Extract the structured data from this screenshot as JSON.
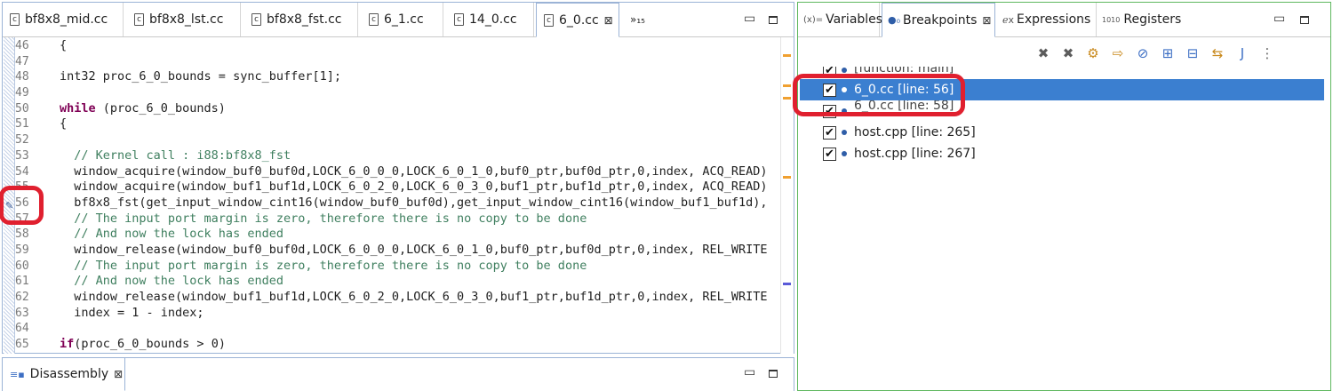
{
  "editor": {
    "tabs": [
      {
        "label": "bf8x8_mid.cc"
      },
      {
        "label": "bf8x8_lst.cc"
      },
      {
        "label": "bf8x8_fst.cc"
      },
      {
        "label": "6_1.cc"
      },
      {
        "label": "14_0.cc"
      },
      {
        "label": "6_0.cc",
        "active": true
      }
    ],
    "overflow_label": "»₁₅",
    "lines": [
      {
        "n": "46",
        "text": "{"
      },
      {
        "n": "47",
        "text": ""
      },
      {
        "n": "48",
        "text": "int32 proc_6_0_bounds = sync_buffer[1];"
      },
      {
        "n": "49",
        "text": ""
      },
      {
        "n": "50",
        "kw": "while",
        "text": " (proc_6_0_bounds)"
      },
      {
        "n": "51",
        "text": "{"
      },
      {
        "n": "52",
        "text": ""
      },
      {
        "n": "53",
        "comment": "  // Kernel call : i88:bf8x8_fst"
      },
      {
        "n": "54",
        "text": "  window_acquire(window_buf0_buf0d,LOCK_6_0_0_0,LOCK_6_0_1_0,buf0_ptr,buf0d_ptr,0,index, ACQ_READ)"
      },
      {
        "n": "55",
        "text": "  window_acquire(window_buf1_buf1d,LOCK_6_0_2_0,LOCK_6_0_3_0,buf1_ptr,buf1d_ptr,0,index, ACQ_READ)"
      },
      {
        "n": "56",
        "text": "  bf8x8_fst(get_input_window_cint16(window_buf0_buf0d),get_input_window_cint16(window_buf1_buf1d),"
      },
      {
        "n": "57",
        "comment": "  // The input port margin is zero, therefore there is no copy to be done"
      },
      {
        "n": "58",
        "comment": "  // And now the lock has ended"
      },
      {
        "n": "59",
        "text": "  window_release(window_buf0_buf0d,LOCK_6_0_0_0,LOCK_6_0_1_0,buf0_ptr,buf0d_ptr,0,index, REL_WRITE"
      },
      {
        "n": "60",
        "comment": "  // The input port margin is zero, therefore there is no copy to be done"
      },
      {
        "n": "61",
        "comment": "  // And now the lock has ended"
      },
      {
        "n": "62",
        "text": "  window_release(window_buf1_buf1d,LOCK_6_0_2_0,LOCK_6_0_3_0,buf1_ptr,buf1d_ptr,0,index, REL_WRITE"
      },
      {
        "n": "63",
        "text": "  index = 1 - index;"
      },
      {
        "n": "64",
        "text": ""
      },
      {
        "n": "65",
        "kw": "if",
        "text": "(proc_6_0_bounds > 0)"
      }
    ]
  },
  "disassembly": {
    "tab_label": "Disassembly"
  },
  "debug": {
    "tabs": [
      {
        "icon": "(x)=",
        "label": "Variables"
      },
      {
        "icon": "●₀",
        "label": "Breakpoints",
        "active": true
      },
      {
        "icon": "ℯx",
        "label": "Expressions"
      },
      {
        "icon": "1010",
        "label": "Registers"
      }
    ],
    "breakpoints": [
      {
        "label": "[function: main]",
        "checked": true,
        "partial": true
      },
      {
        "label": "6_0.cc [line: 56]",
        "checked": true,
        "selected": true
      },
      {
        "label": "6_0.cc [line: 58]",
        "checked": true,
        "partial": true
      },
      {
        "label": "host.cpp [line: 265]",
        "checked": true
      },
      {
        "label": "host.cpp [line: 267]",
        "checked": true
      }
    ]
  },
  "colors": {
    "selection": "#3b7fd0",
    "highlight_ring": "#e0202f",
    "keyword": "#7f0055",
    "comment": "#3f7f5f"
  }
}
